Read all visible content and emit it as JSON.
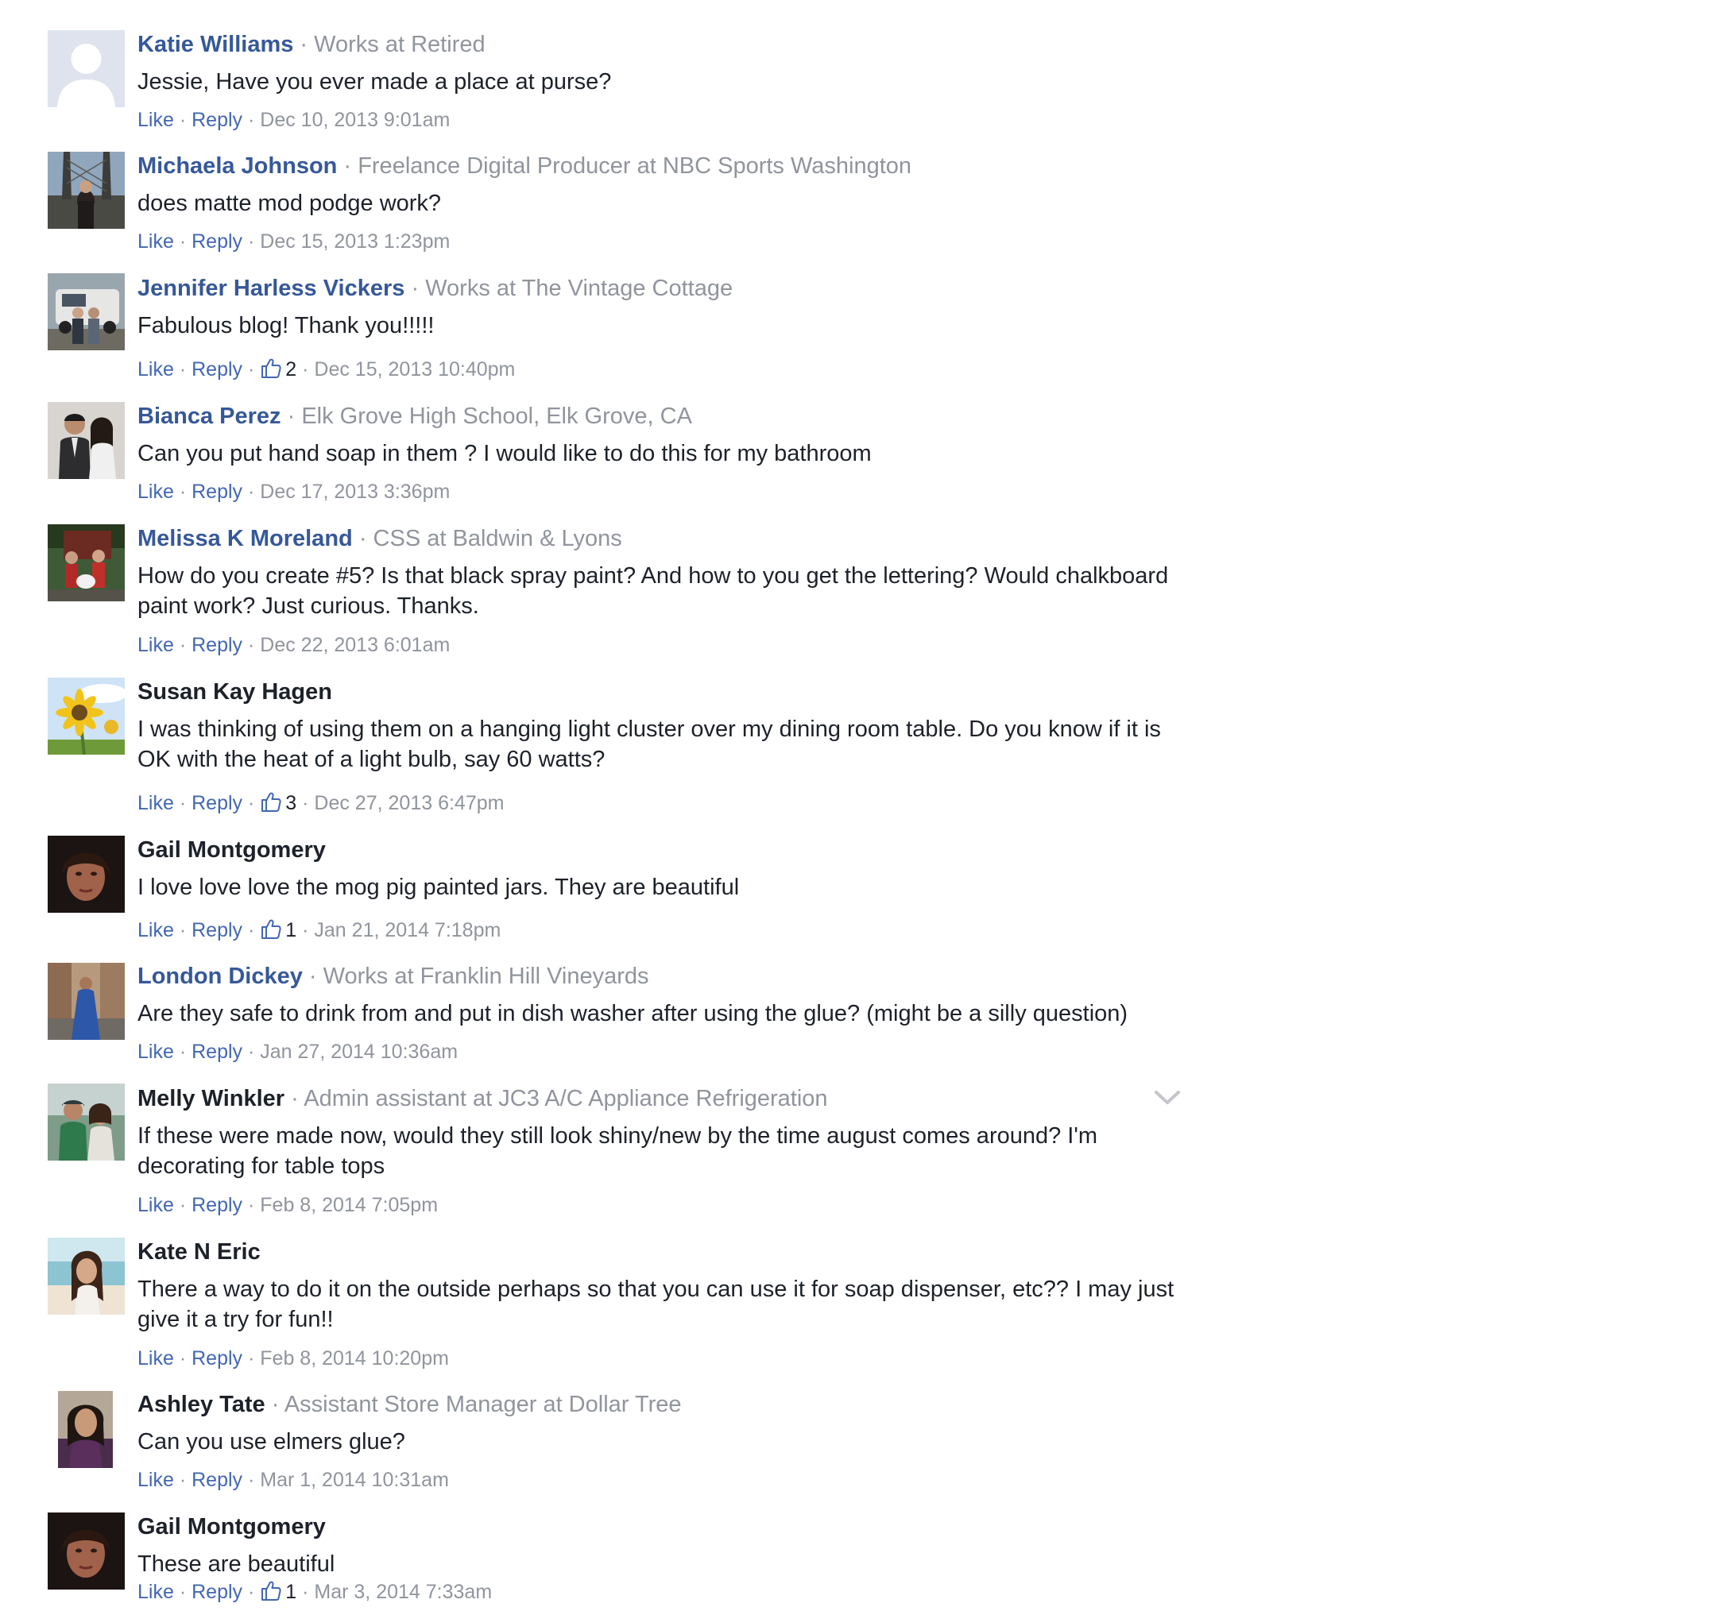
{
  "separator": "·",
  "action_like": "Like",
  "action_reply": "Reply",
  "comments": [
    {
      "author": "Katie Williams",
      "subtitle": "Works at Retired",
      "text": "Jessie, Have you ever made a place at purse?",
      "likes": "",
      "timestamp": "Dec 10, 2013 9:01am",
      "avatar": "default-silhouette"
    },
    {
      "author": "Michaela Johnson",
      "subtitle": "Freelance Digital Producer at NBC Sports Washington",
      "text": "does matte mod podge work?",
      "likes": "",
      "timestamp": "Dec 15, 2013 1:23pm",
      "avatar": "bridge-photo"
    },
    {
      "author": "Jennifer Harless Vickers",
      "subtitle": "Works at The Vintage Cottage",
      "text": "Fabulous blog! Thank you!!!!!",
      "likes": "2",
      "timestamp": "Dec 15, 2013 10:40pm",
      "avatar": "truck-photo"
    },
    {
      "author": "Bianca Perez",
      "subtitle": "Elk Grove High School, Elk Grove, CA",
      "text": "Can you put hand soap in them ? I would like to do this for my bathroom",
      "likes": "",
      "timestamp": "Dec 17, 2013 3:36pm",
      "avatar": "couple-photo"
    },
    {
      "author": "Melissa K Moreland",
      "subtitle": "CSS at Baldwin & Lyons",
      "text": "How do you create #5? Is that black spray paint? And how to you get the lettering? Would chalkboard paint work? Just curious. Thanks.",
      "likes": "",
      "timestamp": "Dec 22, 2013 6:01am",
      "avatar": "family-photo"
    },
    {
      "author": "Susan Kay Hagen",
      "subtitle": "",
      "text": "I was thinking of using them on a hanging light cluster over my dining room table. Do you know if it is OK with the heat of a light bulb, say 60 watts?",
      "likes": "3",
      "timestamp": "Dec 27, 2013 6:47pm",
      "avatar": "sunflower-photo"
    },
    {
      "author": "Gail Montgomery",
      "subtitle": "",
      "text": "I love love love the mog pig painted jars. They are beautiful",
      "likes": "1",
      "timestamp": "Jan 21, 2014 7:18pm",
      "avatar": "portrait-photo"
    },
    {
      "author": "London Dickey",
      "subtitle": "Works at Franklin Hill Vineyards",
      "text": "Are they safe to drink from and put in dish washer after using the glue? (might be a silly question)",
      "likes": "",
      "timestamp": "Jan 27, 2014 10:36am",
      "avatar": "blue-dress-photo"
    },
    {
      "author": "Melly Winkler",
      "subtitle": "Admin assistant at JC3 A/C Appliance Refrigeration",
      "text": "If these were made now, would they still look shiny/new by the time august comes around? I'm decorating for table tops",
      "likes": "",
      "timestamp": "Feb 8, 2014 7:05pm",
      "avatar": "couple-green-photo"
    },
    {
      "author": "Kate N Eric",
      "subtitle": "",
      "text": "There a way to do it on the outside perhaps so that you can use it for soap dispenser, etc?? I may just give it a try for fun!!",
      "likes": "",
      "timestamp": "Feb 8, 2014 10:20pm",
      "avatar": "beach-photo"
    },
    {
      "author": "Ashley Tate",
      "subtitle": "Assistant Store Manager at Dollar Tree",
      "text": "Can you use elmers glue?",
      "likes": "",
      "timestamp": "Mar 1, 2014 10:31am",
      "avatar": "selfie-photo"
    },
    {
      "author": "Gail Montgomery",
      "subtitle": "",
      "text": "These are beautiful",
      "likes": "1",
      "timestamp": "Mar 3, 2014 7:33am",
      "avatar": "portrait-photo"
    }
  ]
}
